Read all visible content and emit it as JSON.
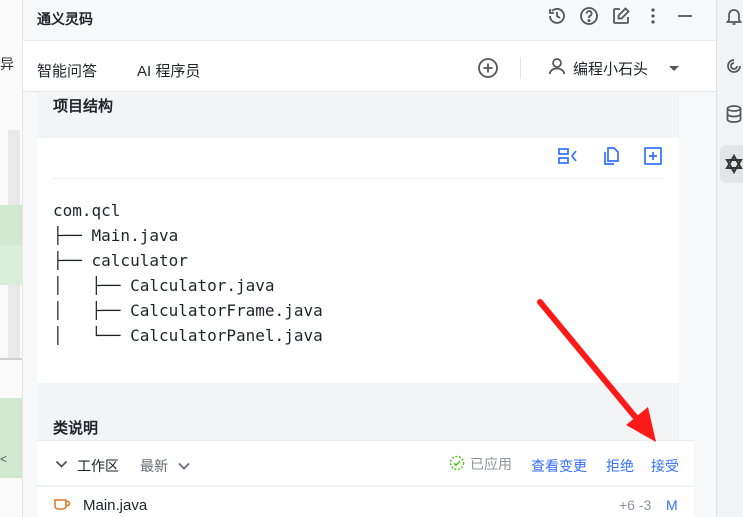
{
  "left_strip": {
    "partial_text": "异",
    "close_char": "<"
  },
  "header": {
    "title": "通义灵码",
    "icons": [
      "history-icon",
      "help-icon",
      "edit-icon",
      "more-vertical-icon",
      "minimize-icon"
    ]
  },
  "tabs": [
    {
      "label": "智能问答",
      "active": false
    },
    {
      "label": "AI 程序员",
      "active": true
    }
  ],
  "user": {
    "name": "编程小石头"
  },
  "content": {
    "section1_title": "项目结构",
    "code_lines": [
      "com.qcl",
      "├── Main.java",
      "├── calculator",
      "│   ├── Calculator.java",
      "│   ├── CalculatorFrame.java",
      "│   └── CalculatorPanel.java"
    ],
    "section2_title": "类说明"
  },
  "workspace": {
    "label": "工作区",
    "latest_label": "最新",
    "applied_label": "已应用",
    "view_changes_label": "查看变更",
    "reject_label": "拒绝",
    "accept_label": "接受"
  },
  "file": {
    "name": "Main.java",
    "diff": "+6 -3",
    "status": "M"
  },
  "colors": {
    "accent": "#3370ff",
    "annotation": "#ff1a1a",
    "success": "#52c41a"
  }
}
